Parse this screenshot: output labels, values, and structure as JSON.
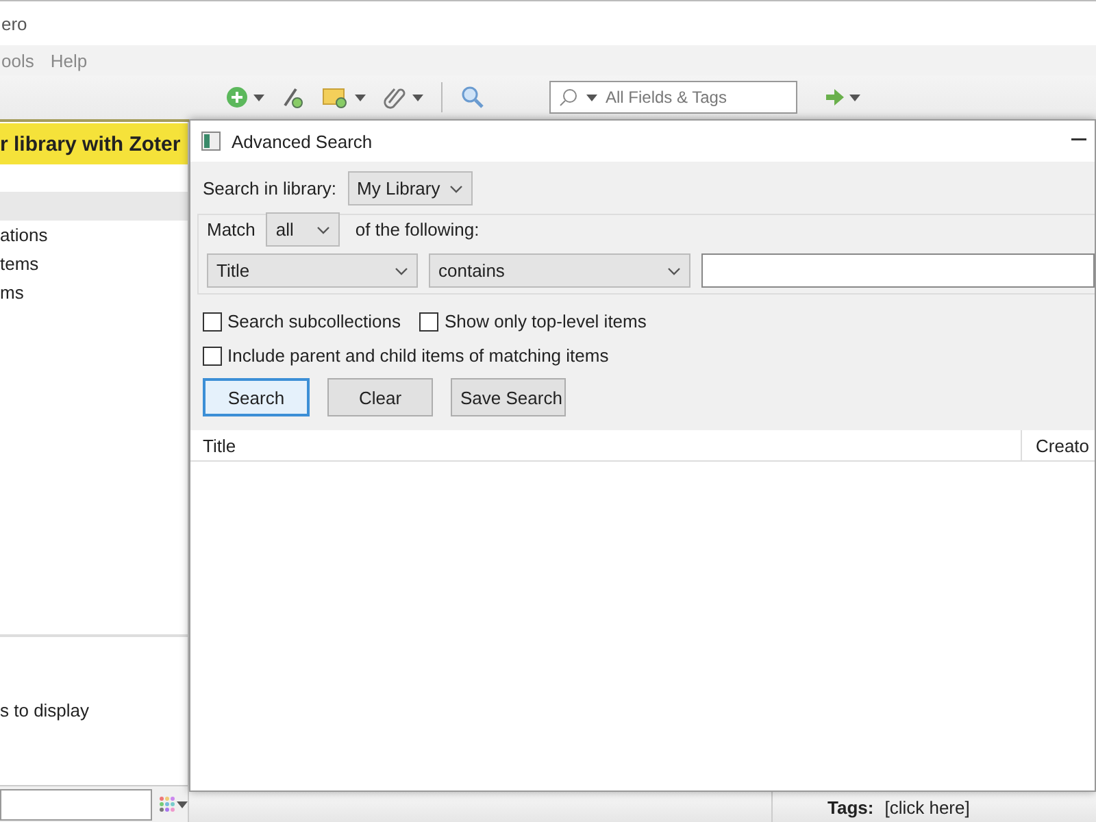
{
  "app": {
    "title": "ero",
    "menu": [
      {
        "label": "ools"
      },
      {
        "label": "Help"
      }
    ],
    "search": {
      "placeholder": "All Fields & Tags"
    },
    "banner": "r library with Zoter",
    "collections": [
      {
        "selected": true
      },
      {
        "label": "ations",
        "selected": false
      },
      {
        "label": "tems",
        "selected": false
      },
      {
        "label": "ms",
        "selected": false
      }
    ],
    "item_pane_message": "s to display",
    "tags_pane": {
      "label": "Tags:",
      "value": "[click here]"
    }
  },
  "dialog": {
    "title": "Advanced Search",
    "library_label": "Search in library:",
    "library": "My Library",
    "match_label": "Match",
    "match": "all",
    "match_suffix": "of the following:",
    "condition": {
      "field": "Title",
      "operator": "contains"
    },
    "options": [
      {
        "label": "Search subcollections",
        "checked": false
      },
      {
        "label": "Show only top-level items",
        "checked": false
      },
      {
        "label": "Include parent and child items of matching items",
        "checked": false
      }
    ],
    "buttons": [
      {
        "label": "Search",
        "default": true
      },
      {
        "label": "Clear",
        "default": false
      },
      {
        "label": "Save Search",
        "default": false
      }
    ],
    "columns": [
      "Title",
      "Creato"
    ]
  }
}
